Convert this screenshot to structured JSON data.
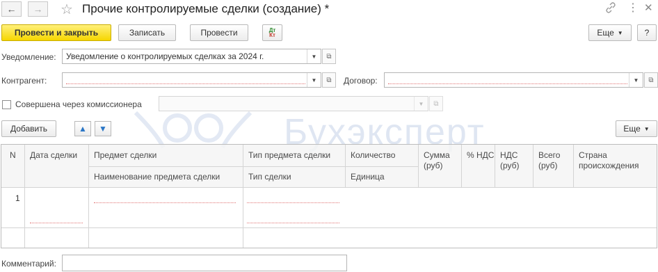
{
  "window": {
    "title": "Прочие контролируемые сделки (создание) *",
    "back_icon": "←",
    "forward_icon": "→"
  },
  "toolbar": {
    "post_close_label": "Провести и закрыть",
    "save_label": "Записать",
    "post_label": "Провести",
    "dtkt_top": "Дт",
    "dtkt_bottom": "Кт",
    "more_label": "Еще",
    "help_label": "?"
  },
  "form": {
    "notification_label": "Уведомление:",
    "notification_value": "Уведомление о контролируемых сделках за 2024 г.",
    "counterparty_label": "Контрагент:",
    "counterparty_value": "",
    "contract_label": "Договор:",
    "contract_value": "",
    "commissioner_label": "Совершена через комиссионера",
    "commissioner_checked": false,
    "commissioner_value": ""
  },
  "table_toolbar": {
    "add_label": "Добавить",
    "more_label": "Еще"
  },
  "watermark": "Бухэксперт",
  "table": {
    "headers": {
      "n": "N",
      "date": "Дата сделки",
      "subject": "Предмет сделки",
      "subject_name": "Наименование предмета сделки",
      "subject_type": "Тип предмета сделки",
      "deal_type": "Тип сделки",
      "quantity": "Количество",
      "unit": "Единица",
      "sum": "Сумма (руб)",
      "vat_pct": "% НДС",
      "vat": "НДС (руб)",
      "total": "Всего (руб)",
      "country": "Страна происхождения"
    },
    "rows": [
      {
        "n": "1"
      }
    ]
  },
  "comment": {
    "label": "Комментарий:",
    "value": ""
  },
  "colors": {
    "primary_button": "#f6d600",
    "arrow_blue": "#2a76c6",
    "required_marker": "#e07070"
  }
}
